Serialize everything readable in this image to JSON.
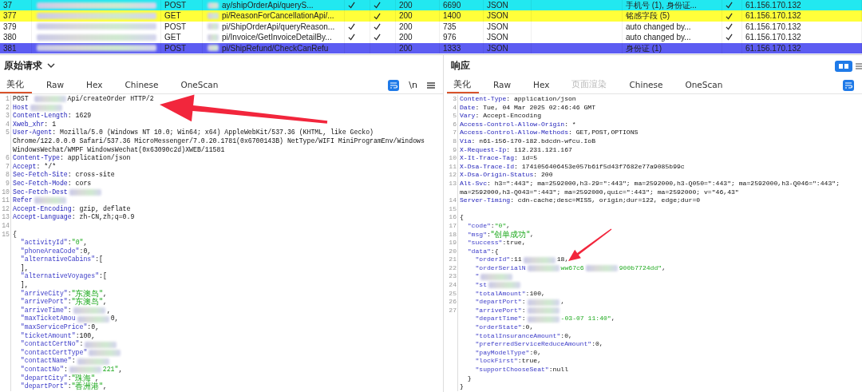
{
  "history_table": {
    "rows": [
      {
        "number": "37",
        "host_redacted": true,
        "method": "POST",
        "url": "ay/shipOrderApi/queryS...",
        "column_5": true,
        "column_6": true,
        "status": "200",
        "length": "6690",
        "mime": "JSON",
        "comment": "手机号 (1), 身份证...",
        "column_11": true,
        "ip": "61.156.170.132",
        "color": "#22e8f0"
      },
      {
        "number": "377",
        "host_redacted": true,
        "method": "GET",
        "url": "pi/ReasonForCancellationApi/...",
        "column_5": false,
        "column_6": true,
        "status": "200",
        "length": "1400",
        "mime": "JSON",
        "comment": "铭感字段 (5)",
        "column_11": true,
        "ip": "61.156.170.132",
        "color": "#ffff3a"
      },
      {
        "number": "379",
        "host_redacted": true,
        "method": "POST",
        "url": "pi/ShipOrderApi/queryReason...",
        "column_5": true,
        "column_6": true,
        "status": "200",
        "length": "735",
        "mime": "JSON",
        "comment": "auto changed by...",
        "column_11": true,
        "ip": "61.156.170.132",
        "color": "#ffffff"
      },
      {
        "number": "380",
        "host_redacted": true,
        "method": "GET",
        "url": "pi/Invoice/GetInvoiceDetailBy...",
        "column_5": true,
        "column_6": true,
        "status": "200",
        "length": "976",
        "mime": "JSON",
        "comment": "auto changed by...",
        "column_11": true,
        "ip": "61.156.170.132",
        "color": "#ffffff"
      },
      {
        "number": "381",
        "host_redacted": true,
        "method": "POST",
        "url": "pi/ShipRefund/CheckCanRefu",
        "column_5": false,
        "column_6": false,
        "status": "200",
        "length": "1333",
        "mime": "JSON",
        "comment": "身份证 (1)",
        "column_11": false,
        "ip": "61.156.170.132",
        "color": "#5c5cf2"
      }
    ]
  },
  "request": {
    "title": "原始请求",
    "tabs": [
      {
        "label": "美化",
        "selected": true,
        "disabled": false
      },
      {
        "label": "Raw",
        "selected": false,
        "disabled": false
      },
      {
        "label": "Hex",
        "selected": false,
        "disabled": false
      },
      {
        "label": "Chinese",
        "selected": false,
        "disabled": false
      },
      {
        "label": "OneScan",
        "selected": false,
        "disabled": false
      }
    ],
    "newline_toggle": "\\n",
    "lines": [
      {
        "n": "1",
        "parts": [
          {
            "kind": "text",
            "text": "POST "
          },
          {
            "kind": "redacted"
          },
          {
            "kind": "text",
            "text": "Api/createOrder HTTP/2"
          }
        ]
      },
      {
        "n": "2",
        "parts": [
          {
            "kind": "name",
            "text": "Host"
          },
          {
            "kind": "redacted"
          }
        ]
      },
      {
        "n": "3",
        "parts": [
          {
            "kind": "name",
            "text": "Content-Length"
          },
          {
            "kind": "text",
            "text": ": 1629"
          }
        ]
      },
      {
        "n": "4",
        "parts": [
          {
            "kind": "name",
            "text": "Xweb_xhr"
          },
          {
            "kind": "text",
            "text": ": 1"
          }
        ]
      },
      {
        "n": "5",
        "parts": [
          {
            "kind": "name",
            "text": "User-Agent"
          },
          {
            "kind": "text",
            "text": ": Mozilla/5.0 (Windows NT 10.0; Win64; x64) AppleWebKit/537.36 (KHTML, like Gecko)"
          }
        ]
      },
      {
        "parts": [
          {
            "kind": "text",
            "text": "Chrome/122.0.0.0 Safari/537.36 MicroMessenger/7.0.20.1781(0x6700143B) NetType/WIFI MiniProgramEnv/Windows"
          }
        ]
      },
      {
        "parts": [
          {
            "kind": "text",
            "text": "WindowsWechat/WMPF WindowsWechat(0x63090c2d)XWEB/11581"
          }
        ]
      },
      {
        "n": "6",
        "parts": [
          {
            "kind": "name",
            "text": "Content-Type"
          },
          {
            "kind": "text",
            "text": ": application/json"
          }
        ]
      },
      {
        "n": "7",
        "parts": [
          {
            "kind": "name",
            "text": "Accept"
          },
          {
            "kind": "text",
            "text": ": */*"
          }
        ]
      },
      {
        "n": "8",
        "parts": [
          {
            "kind": "name",
            "text": "Sec-Fetch-Site"
          },
          {
            "kind": "text",
            "text": ": cross-site"
          }
        ]
      },
      {
        "n": "9",
        "parts": [
          {
            "kind": "name",
            "text": "Sec-Fetch-Mode"
          },
          {
            "kind": "text",
            "text": ": cors"
          }
        ]
      },
      {
        "n": "10",
        "parts": [
          {
            "kind": "name",
            "text": "Sec-Fetch-Dest"
          },
          {
            "kind": "redacted"
          }
        ]
      },
      {
        "n": "11",
        "parts": [
          {
            "kind": "name",
            "text": "Refer"
          },
          {
            "kind": "redacted"
          }
        ]
      },
      {
        "n": "12",
        "parts": [
          {
            "kind": "name",
            "text": "Accept-Encoding"
          },
          {
            "kind": "text",
            "text": ": gzip, deflate"
          }
        ]
      },
      {
        "n": "13",
        "parts": [
          {
            "kind": "name",
            "text": "Accept-Language"
          },
          {
            "kind": "text",
            "text": ": zh-CN,zh;q=0.9"
          }
        ]
      },
      {
        "n": "14"
      },
      {
        "n": "15",
        "parts": [
          {
            "kind": "text",
            "text": "{"
          }
        ]
      },
      {
        "parts": [
          {
            "kind": "key",
            "text": "  \"activityId\""
          },
          {
            "kind": "text",
            "text": ":"
          },
          {
            "kind": "str",
            "text": "\"0\""
          },
          {
            "kind": "text",
            "text": ","
          }
        ]
      },
      {
        "parts": [
          {
            "kind": "key",
            "text": "  \"phoneAreaCode\""
          },
          {
            "kind": "text",
            "text": ":0,"
          }
        ]
      },
      {
        "parts": [
          {
            "kind": "key",
            "text": "  \"alternativeCabins\""
          },
          {
            "kind": "text",
            "text": ":["
          }
        ]
      },
      {
        "parts": [
          {
            "kind": "text",
            "text": "  ],"
          }
        ]
      },
      {
        "parts": [
          {
            "kind": "key",
            "text": "  \"alternativeVoyages\""
          },
          {
            "kind": "text",
            "text": ":["
          }
        ]
      },
      {
        "parts": [
          {
            "kind": "text",
            "text": "  ],"
          }
        ]
      },
      {
        "parts": [
          {
            "kind": "key",
            "text": "  \"arriveCity\""
          },
          {
            "kind": "text",
            "text": ":"
          },
          {
            "kind": "str",
            "text": "\"东澳岛\""
          },
          {
            "kind": "text",
            "text": ","
          }
        ]
      },
      {
        "parts": [
          {
            "kind": "key",
            "text": "  \"arrivePort\""
          },
          {
            "kind": "text",
            "text": ":"
          },
          {
            "kind": "str",
            "text": "\"东澳岛\""
          },
          {
            "kind": "text",
            "text": ","
          }
        ]
      },
      {
        "parts": [
          {
            "kind": "key",
            "text": "  \"arriveTime\""
          },
          {
            "kind": "text",
            "text": ":"
          },
          {
            "kind": "redacted"
          },
          {
            "kind": "text",
            "text": ","
          }
        ]
      },
      {
        "parts": [
          {
            "kind": "key",
            "text": "  \"maxTicketAmou"
          },
          {
            "kind": "redacted"
          },
          {
            "kind": "text",
            "text": "0,"
          }
        ]
      },
      {
        "parts": [
          {
            "kind": "key",
            "text": "  \"maxServicePrice\""
          },
          {
            "kind": "text",
            "text": ":0,"
          }
        ]
      },
      {
        "parts": [
          {
            "kind": "key",
            "text": "  \"ticketAmount\""
          },
          {
            "kind": "text",
            "text": ":100,"
          }
        ]
      },
      {
        "parts": [
          {
            "kind": "key",
            "text": "  \"contactCertNo\""
          },
          {
            "kind": "text",
            "text": ":"
          },
          {
            "kind": "redacted"
          }
        ]
      },
      {
        "parts": [
          {
            "kind": "key",
            "text": "  \"contactCertType\""
          },
          {
            "kind": "redacted"
          }
        ]
      },
      {
        "parts": [
          {
            "kind": "key",
            "text": "  \"contactName\""
          },
          {
            "kind": "text",
            "text": ":"
          },
          {
            "kind": "redacted"
          }
        ]
      },
      {
        "parts": [
          {
            "kind": "key",
            "text": "  \"contactNo\""
          },
          {
            "kind": "text",
            "text": ":"
          },
          {
            "kind": "redacted"
          },
          {
            "kind": "str",
            "text": "221\""
          },
          {
            "kind": "text",
            "text": ","
          }
        ]
      },
      {
        "parts": [
          {
            "kind": "key",
            "text": "  \"departCity\""
          },
          {
            "kind": "text",
            "text": ":"
          },
          {
            "kind": "str",
            "text": "\"珠海\""
          },
          {
            "kind": "text",
            "text": ","
          }
        ]
      },
      {
        "parts": [
          {
            "kind": "key",
            "text": "  \"departPort\""
          },
          {
            "kind": "text",
            "text": ":"
          },
          {
            "kind": "str",
            "text": "\"香洲港\""
          },
          {
            "kind": "text",
            "text": ","
          }
        ]
      }
    ]
  },
  "response": {
    "title": "响应",
    "tabs": [
      {
        "label": "美化",
        "selected": true,
        "disabled": false
      },
      {
        "label": "Raw",
        "selected": false,
        "disabled": false
      },
      {
        "label": "Hex",
        "selected": false,
        "disabled": false
      },
      {
        "label": "页面渲染",
        "selected": false,
        "disabled": true
      },
      {
        "label": "Chinese",
        "selected": false,
        "disabled": false
      },
      {
        "label": "OneScan",
        "selected": false,
        "disabled": false
      }
    ],
    "lines": [
      {
        "n": "3",
        "parts": [
          {
            "kind": "name",
            "text": "Content-Type"
          },
          {
            "kind": "text",
            "text": ": application/json"
          }
        ]
      },
      {
        "n": "4",
        "parts": [
          {
            "kind": "name",
            "text": "Date"
          },
          {
            "kind": "text",
            "text": ": Tue, 04 Mar 2025 02:46:46 GMT"
          }
        ]
      },
      {
        "n": "5",
        "parts": [
          {
            "kind": "name",
            "text": "Vary"
          },
          {
            "kind": "text",
            "text": ": Accept-Encoding"
          }
        ]
      },
      {
        "n": "6",
        "parts": [
          {
            "kind": "name",
            "text": "Access-Control-Allow-Origin"
          },
          {
            "kind": "text",
            "text": ": *"
          }
        ]
      },
      {
        "n": "7",
        "parts": [
          {
            "kind": "name",
            "text": "Access-Control-Allow-Methods"
          },
          {
            "kind": "text",
            "text": ": GET,POST,OPTIONS"
          }
        ]
      },
      {
        "n": "8",
        "parts": [
          {
            "kind": "name",
            "text": "Via"
          },
          {
            "kind": "text",
            "text": ": n61-156-170-182.bdcdn-wfcu.IoB"
          }
        ]
      },
      {
        "n": "9",
        "parts": [
          {
            "kind": "name",
            "text": "X-Request-Ip"
          },
          {
            "kind": "text",
            "text": ": 112.231.121.167"
          }
        ]
      },
      {
        "n": "10",
        "parts": [
          {
            "kind": "name",
            "text": "X-It-Trace-Tag"
          },
          {
            "kind": "text",
            "text": ": id=5"
          }
        ]
      },
      {
        "n": "11",
        "parts": [
          {
            "kind": "name",
            "text": "X-Dsa-Trace-Id"
          },
          {
            "kind": "text",
            "text": ": 1741056406453e057b61f5d43f7682e77a9085b99c"
          }
        ]
      },
      {
        "n": "12",
        "parts": [
          {
            "kind": "name",
            "text": "X-Dsa-Origin-Status"
          },
          {
            "kind": "text",
            "text": ": 200"
          }
        ]
      },
      {
        "n": "13",
        "parts": [
          {
            "kind": "name",
            "text": "Alt-Svc"
          },
          {
            "kind": "text",
            "text": ": h3=\":443\"; ma=2592000,h3-29=\":443\"; ma=2592000,h3-Q050=\":443\"; ma=2592000,h3-Q046=\":443\";"
          }
        ]
      },
      {
        "parts": [
          {
            "kind": "text",
            "text": "ma=2592000,h3-Q043=\":443\"; ma=2592000,quic=\":443\"; ma=2592000; v=\"46,43\""
          }
        ]
      },
      {
        "n": "14",
        "parts": [
          {
            "kind": "name",
            "text": "Server-Timing"
          },
          {
            "kind": "text",
            "text": ": cdn-cache;desc=MISS, origin;dur=122, edge;dur=0"
          }
        ]
      },
      {
        "n": "15"
      },
      {
        "n": "16",
        "parts": [
          {
            "kind": "text",
            "text": "{"
          }
        ]
      },
      {
        "n": "17",
        "parts": [
          {
            "kind": "key",
            "text": "  \"code\""
          },
          {
            "kind": "text",
            "text": ":"
          },
          {
            "kind": "str",
            "text": "\"0\""
          },
          {
            "kind": "text",
            "text": ","
          }
        ]
      },
      {
        "n": "18",
        "parts": [
          {
            "kind": "key",
            "text": "  \"msg\""
          },
          {
            "kind": "text",
            "text": ":"
          },
          {
            "kind": "str",
            "text": "\"创单成功\""
          },
          {
            "kind": "text",
            "text": ","
          }
        ]
      },
      {
        "n": "19",
        "parts": [
          {
            "kind": "key",
            "text": "  \"success\""
          },
          {
            "kind": "text",
            "text": ":true,"
          }
        ]
      },
      {
        "n": "20",
        "parts": [
          {
            "kind": "key",
            "text": "  \"data\""
          },
          {
            "kind": "text",
            "text": ":{"
          }
        ]
      },
      {
        "n": "21",
        "parts": [
          {
            "kind": "key",
            "text": "    \"orderId\""
          },
          {
            "kind": "text",
            "text": ":11"
          },
          {
            "kind": "redacted"
          },
          {
            "kind": "text",
            "text": "18,"
          }
        ]
      },
      {
        "n": "22",
        "parts": [
          {
            "kind": "key",
            "text": "    \"orderSerialN"
          },
          {
            "kind": "redacted"
          },
          {
            "kind": "str",
            "text": "ww67c6"
          },
          {
            "kind": "redacted"
          },
          {
            "kind": "str",
            "text": "900b7724dd\""
          },
          {
            "kind": "text",
            "text": ","
          }
        ]
      },
      {
        "n": "23",
        "parts": [
          {
            "kind": "key",
            "text": "    \""
          },
          {
            "kind": "redacted"
          }
        ]
      },
      {
        "n": "24",
        "parts": [
          {
            "kind": "key",
            "text": "    \"st"
          },
          {
            "kind": "redacted"
          }
        ]
      },
      {
        "n": "25",
        "parts": [
          {
            "kind": "key",
            "text": "    \"totalAmount\""
          },
          {
            "kind": "text",
            "text": ":100,"
          }
        ]
      },
      {
        "n": "26",
        "parts": [
          {
            "kind": "key",
            "text": "    \"departPort\""
          },
          {
            "kind": "text",
            "text": ":"
          },
          {
            "kind": "redacted"
          },
          {
            "kind": "text",
            "text": ","
          }
        ]
      },
      {
        "n": "27",
        "parts": [
          {
            "kind": "key",
            "text": "    \"arrivePort\""
          },
          {
            "kind": "text",
            "text": ":"
          },
          {
            "kind": "redacted"
          }
        ]
      },
      {
        "parts": [
          {
            "kind": "key",
            "text": "    \"departTime\""
          },
          {
            "kind": "text",
            "text": ":"
          },
          {
            "kind": "redacted"
          },
          {
            "kind": "str",
            "text": "-03-07 11:40\""
          },
          {
            "kind": "text",
            "text": ","
          }
        ]
      },
      {
        "parts": [
          {
            "kind": "key",
            "text": "    \"orderState\""
          },
          {
            "kind": "text",
            "text": ":0,"
          }
        ]
      },
      {
        "parts": [
          {
            "kind": "key",
            "text": "    \"totalInsuranceAmount\""
          },
          {
            "kind": "text",
            "text": ":0,"
          }
        ]
      },
      {
        "parts": [
          {
            "kind": "key",
            "text": "    \"preferredServiceReduceAmount\""
          },
          {
            "kind": "text",
            "text": ":0,"
          }
        ]
      },
      {
        "parts": [
          {
            "kind": "key",
            "text": "    \"payModelType\""
          },
          {
            "kind": "text",
            "text": ":0,"
          }
        ]
      },
      {
        "parts": [
          {
            "kind": "key",
            "text": "    \"lockFirst\""
          },
          {
            "kind": "text",
            "text": ":true,"
          }
        ]
      },
      {
        "parts": [
          {
            "kind": "key",
            "text": "    \"supportChooseSeat\""
          },
          {
            "kind": "text",
            "text": ":null"
          }
        ]
      },
      {
        "parts": [
          {
            "kind": "text",
            "text": "  }"
          }
        ]
      },
      {
        "parts": [
          {
            "kind": "text",
            "text": "}"
          }
        ]
      }
    ]
  },
  "annotation_arrows": {
    "request": true,
    "response": true
  }
}
